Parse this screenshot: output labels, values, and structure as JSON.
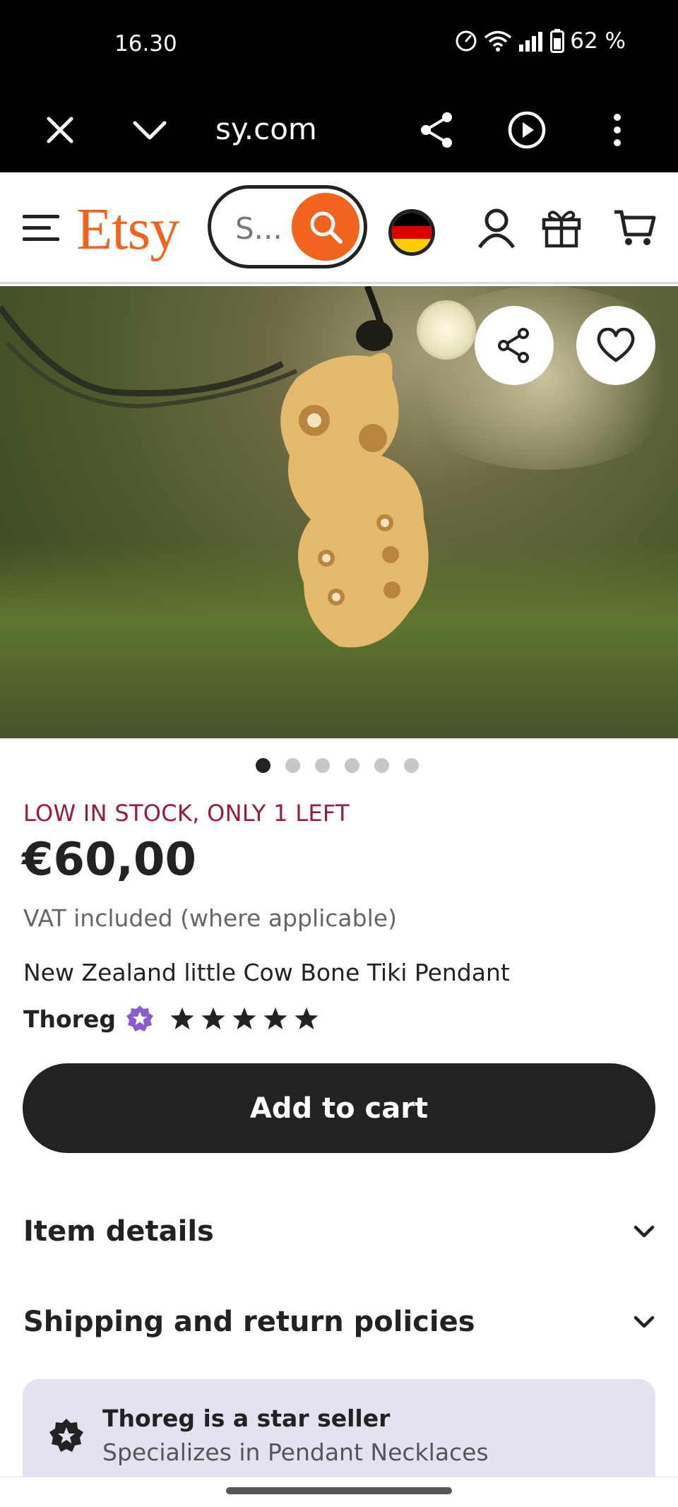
{
  "status_bar": {
    "time": "16.30",
    "battery": "62 %"
  },
  "browser": {
    "url": "sy.com"
  },
  "header": {
    "logo": "Etsy",
    "search_placeholder": "S..."
  },
  "product": {
    "stock_notice": "LOW IN STOCK, ONLY 1 LEFT",
    "price": "€60,00",
    "vat_note": "VAT included (where applicable)",
    "title": "New Zealand little Cow Bone Tiki Pendant",
    "seller": "Thoreg",
    "rating_stars": 5,
    "image_count": 6,
    "active_image": 1
  },
  "actions": {
    "add_to_cart": "Add to cart"
  },
  "accordions": {
    "item_details": "Item details",
    "shipping": "Shipping and return policies"
  },
  "star_seller": {
    "title": "Thoreg is a star seller",
    "subtitle": "Specializes in Pendant Necklaces"
  },
  "colors": {
    "brand": "#f1641e",
    "stock_text": "#9b1b3a",
    "button": "#222222",
    "star_seller_bg": "#e4e2f0",
    "badge": "#8a5bd1"
  }
}
